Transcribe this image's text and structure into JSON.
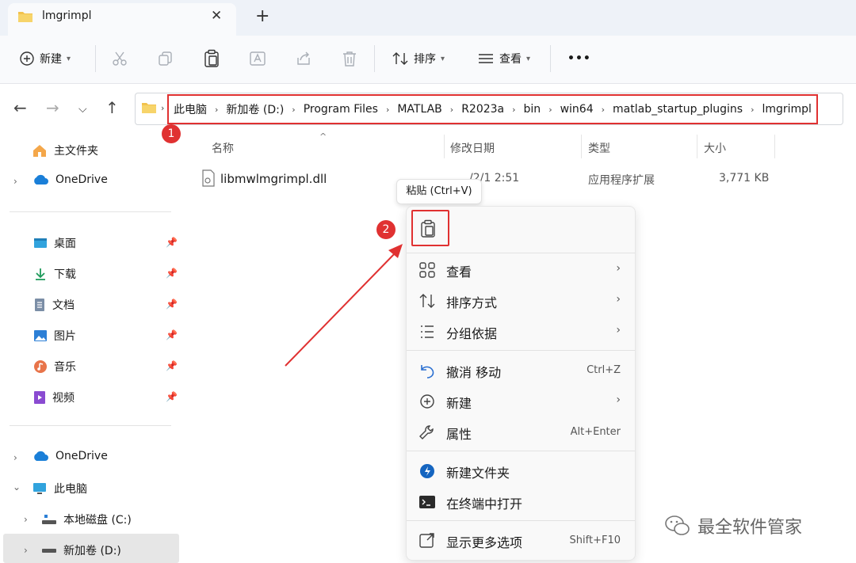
{
  "tab": {
    "title": "lmgrimpl",
    "close": "✕",
    "new": "+"
  },
  "toolbar": {
    "new_label": "新建",
    "sort_label": "排序",
    "view_label": "查看",
    "more": "•••"
  },
  "address": {
    "crumbs": [
      "此电脑",
      "新加卷 (D:)",
      "Program Files",
      "MATLAB",
      "R2023a",
      "bin",
      "win64",
      "matlab_startup_plugins",
      "lmgrimpl"
    ]
  },
  "annotations": {
    "badge1": "1",
    "badge2": "2",
    "accent": "#e03131"
  },
  "sidebar": {
    "home": "主文件夹",
    "onedrive1": "OneDrive",
    "quick": [
      {
        "label": "桌面",
        "icon": "desktop-icon"
      },
      {
        "label": "下载",
        "icon": "download-icon"
      },
      {
        "label": "文档",
        "icon": "document-icon"
      },
      {
        "label": "图片",
        "icon": "picture-icon"
      },
      {
        "label": "音乐",
        "icon": "music-icon"
      },
      {
        "label": "视频",
        "icon": "video-icon"
      }
    ],
    "onedrive2": "OneDrive",
    "thispc": "此电脑",
    "drive_c": "本地磁盘 (C:)",
    "drive_d": "新加卷 (D:)"
  },
  "columns": {
    "name": "名称",
    "modified": "修改日期",
    "type": "类型",
    "size": "大小"
  },
  "file": {
    "name": "libmwlmgrimpl.dll",
    "modified": "/2/1 2:51",
    "type": "应用程序扩展",
    "size": "3,771 KB"
  },
  "tooltip": "粘贴 (Ctrl+V)",
  "menu": {
    "view": "查看",
    "sort": "排序方式",
    "group": "分组依据",
    "undo": "撤消 移动",
    "undo_shortcut": "Ctrl+Z",
    "new": "新建",
    "properties": "属性",
    "properties_shortcut": "Alt+Enter",
    "new_folder": "新建文件夹",
    "terminal": "在终端中打开",
    "more": "显示更多选项",
    "more_shortcut": "Shift+F10"
  },
  "watermark": "最全软件管家"
}
